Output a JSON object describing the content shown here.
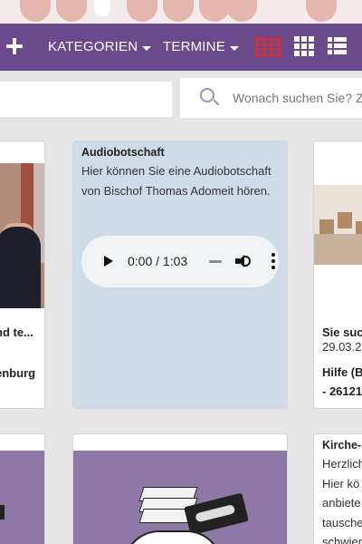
{
  "nav": {
    "categories_label": "KATEGORIEN",
    "dates_label": "TERMINE"
  },
  "search": {
    "placeholder": "Wonach suchen Sie? Z"
  },
  "cards": {
    "left_top": {
      "title_fragment": "nd te...",
      "location_fragment": "enburg"
    },
    "audio": {
      "title": "Audiobotschaft",
      "text": "Hier können Sie eine Audiobotschaft von Bischof Thomas Adomeit hören.",
      "player_time": "0:00 / 1:03"
    },
    "right_top": {
      "title_fragment": "Sie such",
      "date_fragment": "29.03.2",
      "help_fragment": "Hilfe (B",
      "code_fragment": "- 26121"
    },
    "right_bottom": {
      "title_fragment": "Kirche-",
      "lines": [
        "Herzlich",
        "Hier kö",
        "anbiete",
        "tausche",
        "schwier"
      ]
    }
  },
  "colors": {
    "nav_background": "#6b4a8c",
    "active_view_icon": "#d4303c",
    "audio_card_background": "#cfdbe7",
    "image_placeholder_purple": "#8e78a8"
  }
}
